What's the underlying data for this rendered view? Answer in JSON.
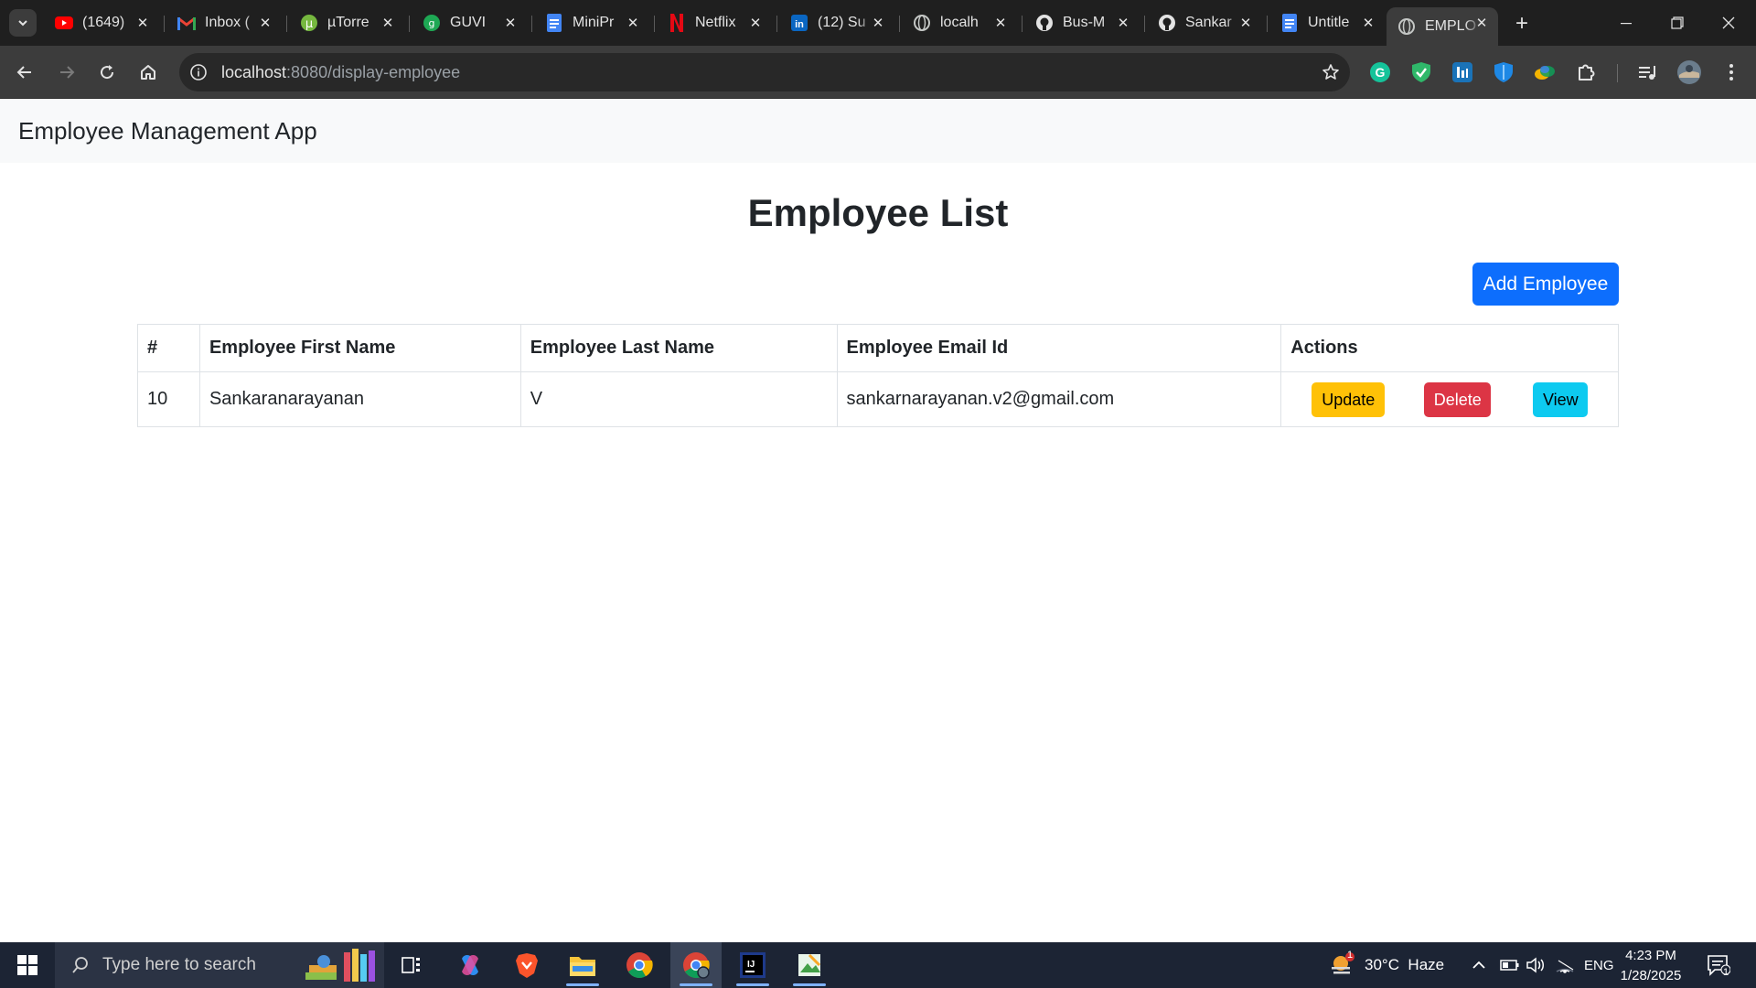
{
  "browser": {
    "tabs": [
      {
        "title": "(1649)",
        "icon": "youtube-icon"
      },
      {
        "title": "Inbox (",
        "icon": "gmail-icon"
      },
      {
        "title": "µTorre",
        "icon": "utorrent-icon"
      },
      {
        "title": "GUVI",
        "icon": "guvi-icon"
      },
      {
        "title": "MiniPr",
        "icon": "google-docs-icon"
      },
      {
        "title": "Netflix",
        "icon": "netflix-icon"
      },
      {
        "title": "(12) Su",
        "icon": "linkedin-icon"
      },
      {
        "title": "localh",
        "icon": "globe-icon"
      },
      {
        "title": "Bus-M",
        "icon": "github-icon"
      },
      {
        "title": "Sankar",
        "icon": "github-icon"
      },
      {
        "title": "Untitle",
        "icon": "google-docs-icon"
      },
      {
        "title": "EMPLO",
        "icon": "globe-icon"
      }
    ],
    "url_host": "localhost",
    "url_rest": ":8080/display-employee"
  },
  "app": {
    "brand": "Employee Management App",
    "title": "Employee List",
    "add_button": "Add Employee",
    "columns": [
      "#",
      "Employee First Name",
      "Employee Last Name",
      "Employee Email Id",
      "Actions"
    ],
    "rows": [
      {
        "id": "10",
        "first_name": "Sankaranarayanan",
        "last_name": "V",
        "email": "sankarnarayanan.v2@gmail.com"
      }
    ],
    "actions": {
      "update": "Update",
      "delete": "Delete",
      "view": "View"
    }
  },
  "taskbar": {
    "search_placeholder": "Type here to search",
    "weather": "30°C  Haze",
    "weather_badge": "1",
    "language": "ENG",
    "time": "4:23 PM",
    "date": "1/28/2025",
    "notification_count": "1"
  },
  "colors": {
    "primary": "#0d6efd",
    "warning": "#ffc107",
    "danger": "#dc3545",
    "info": "#0dcaf0"
  }
}
